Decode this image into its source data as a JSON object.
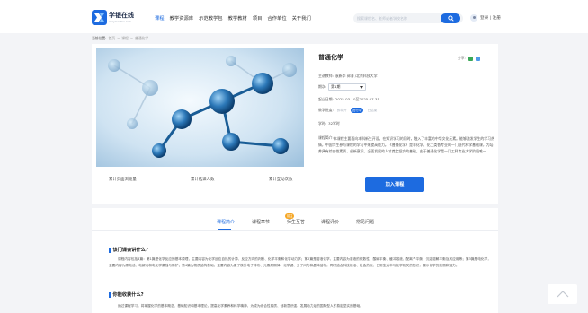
{
  "header": {
    "logo_title": "学银在线",
    "logo_subtitle": "xueyinonline.com",
    "nav": [
      "课程",
      "教学资源库",
      "示范教学包",
      "教学教材",
      "项目",
      "合作单位",
      "关于我们"
    ],
    "search_placeholder": "搜索课程名、老师或者学校名称",
    "login_text": "登录 | 注册",
    "brand_color": "#1d6be0"
  },
  "breadcrumb": {
    "label": "当前位置:",
    "items": [
      "首页",
      ">",
      "课程",
      ">",
      "普通化学"
    ]
  },
  "course": {
    "title": "普通化学",
    "share_label": "分享:",
    "teacher_label": "主讲教师:",
    "teacher_value": "袁新华 郭海 /北京科技大学",
    "term_label": "期次:",
    "term_value": "第1期",
    "date_label": "起止日期:",
    "date_value": "2025-03-10至2025-07-31",
    "status_label": "教学进度:",
    "status_options": [
      "即将开",
      "进行中",
      "已结束"
    ],
    "status_active_index": 1,
    "hours_label": "学时:",
    "hours_value": "32学时",
    "desc_label": "课程简介:",
    "description": "本课程主要面向本科新生开设。在知识学习的同时，融入了丰富的中华文化元素。能够激发学生的学习热情，中国学生参与课程的学习中来提高能力。《普通化学》是非化学、化工类各专业的一门现代科学基础课，为培养具有综合性素质、创新意识、全面发展的人才奠定坚实的基础。由于普通化学是一门工科专业大学阶段唯一...",
    "stats": [
      "累计页面浏览量",
      "累计选课人数",
      "累计互动次数"
    ],
    "join_button": "加入课程"
  },
  "detail": {
    "tabs": [
      "课程简介",
      "课程章节",
      "师生互答",
      "课程评价",
      "常见问题"
    ],
    "active_tab_index": 0,
    "badge": "前往",
    "sections": [
      {
        "title": "该门课会讲什么?",
        "body": "课程内容包括4篇：第1篇是化学反应的基本原理，主要内容为化学反应自热的计算、反应方向的判断、化学平衡和化学动力学；第2篇是溶液化学，主要内容为溶液的依数性、酸碱平衡、缓冲溶液、配离子平衡、沉淀溶解平衡及其应用等；第3篇是电化学，主要内容为原电池、电解池和电化学腐蚀与防护；第4篇为物质结构基础，主要内容为原子核外电子排布、元素周期律、化学键、分子间力和晶体结构。同时结合科技前沿、社会热点、日常生活中与化学相关的知识，展示化学的美丽和魅力。"
      },
      {
        "title": "你能收获什么?",
        "body": "通过课程学习，将掌握化学的基本概念、基础知识和基本理论，提高化学素养和科学精神，为成为综合性素质、创新意识强、发展动力足的国际型人才奠定坚实的基础。"
      }
    ]
  }
}
